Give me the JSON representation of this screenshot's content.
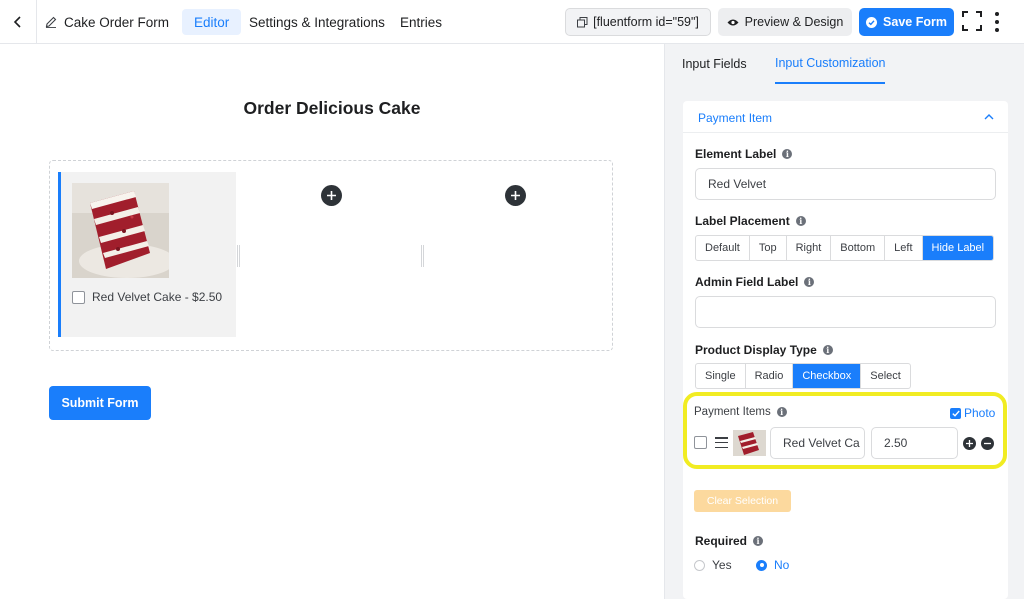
{
  "header": {
    "form_name": "Cake Order Form",
    "tabs": [
      "Editor",
      "Settings & Integrations",
      "Entries"
    ],
    "shortcode": "[fluentform id=\"59\"]",
    "preview_label": "Preview & Design",
    "save_label": "Save Form"
  },
  "canvas": {
    "form_title": "Order Delicious Cake",
    "payment_item_label": "Red Velvet Cake - $2.50",
    "submit_label": "Submit Form"
  },
  "sidebar": {
    "tabs": [
      "Input Fields",
      "Input Customization"
    ],
    "section_title": "Payment Item",
    "element_label": {
      "label": "Element Label",
      "value": "Red Velvet"
    },
    "label_placement": {
      "label": "Label Placement",
      "options": [
        "Default",
        "Top",
        "Right",
        "Bottom",
        "Left",
        "Hide Label"
      ],
      "selected": "Hide Label"
    },
    "admin_field_label": {
      "label": "Admin Field Label",
      "value": ""
    },
    "product_display_type": {
      "label": "Product Display Type",
      "options": [
        "Single",
        "Radio",
        "Checkbox",
        "Select"
      ],
      "selected": "Checkbox"
    },
    "payment_items": {
      "label": "Payment Items",
      "photo_label": "Photo",
      "photo_enabled": true,
      "rows": [
        {
          "label": "Red Velvet Ca",
          "value": "2.50"
        }
      ]
    },
    "clear_selection_label": "Clear Selection",
    "required": {
      "label": "Required",
      "options": [
        "Yes",
        "No"
      ],
      "selected": "No"
    }
  },
  "colors": {
    "accent": "#1a7efb",
    "highlight": "#f1ec22",
    "clear_button": "#fcd99e"
  }
}
